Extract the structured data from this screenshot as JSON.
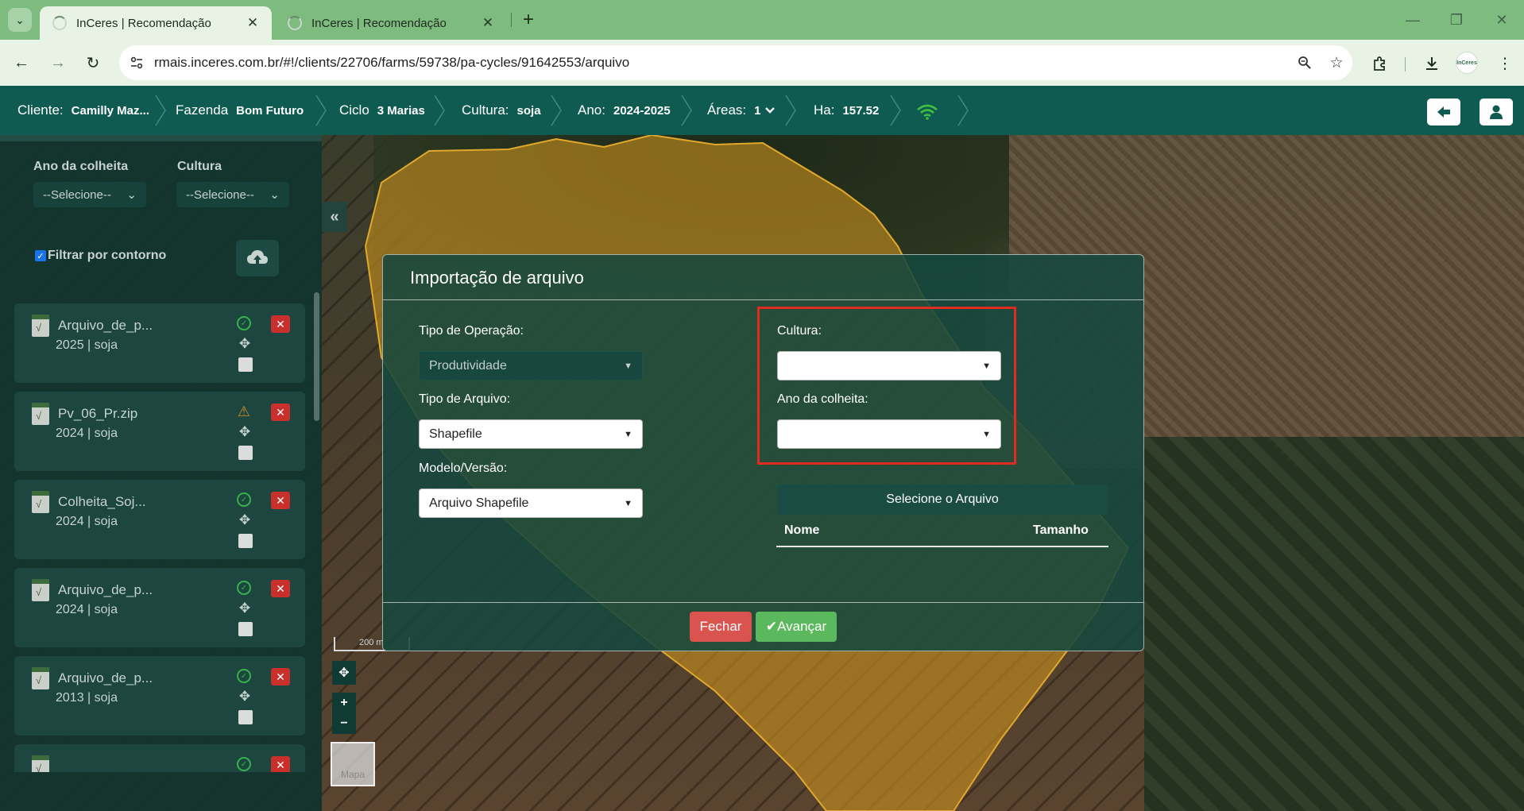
{
  "browser": {
    "tabs": [
      {
        "title": "InCeres | Recomendação",
        "active": true
      },
      {
        "title": "InCeres | Recomendação",
        "active": false
      }
    ],
    "url": "rmais.inceres.com.br/#!/clients/22706/farms/59738/pa-cycles/91642553/arquivo",
    "profile_text": "InCeres"
  },
  "header": {
    "crumbs": [
      {
        "label": "Cliente:",
        "value": "Camilly Maz..."
      },
      {
        "label": "Fazenda",
        "value": "Bom Futuro"
      },
      {
        "label": "Ciclo",
        "value": "3 Marias"
      },
      {
        "label": "Cultura:",
        "value": "soja"
      },
      {
        "label": "Ano:",
        "value": "2024-2025"
      },
      {
        "label": "Áreas:",
        "value": "1"
      },
      {
        "label": "Ha:",
        "value": "157.52"
      }
    ],
    "wifi_color": "#3fbf3f",
    "bar_color": "#0f5b51"
  },
  "sidebar": {
    "filter_year_label": "Ano da colheita",
    "filter_crop_label": "Cultura",
    "filter_year_value": "--Selecione--",
    "filter_crop_value": "--Selecione--",
    "contour_filter_label": "Filtrar por contorno",
    "contour_filter_checked": true,
    "files": [
      {
        "name": "Arquivo_de_p...",
        "sub": "2025 | soja",
        "status": "ok"
      },
      {
        "name": "Pv_06_Pr.zip",
        "sub": "2024 | soja",
        "status": "warning"
      },
      {
        "name": "Colheita_Soj...",
        "sub": "2024 | soja",
        "status": "ok"
      },
      {
        "name": "Arquivo_de_p...",
        "sub": "2024 | soja",
        "status": "ok"
      },
      {
        "name": "Arquivo_de_p...",
        "sub": "2013 | soja",
        "status": "ok"
      }
    ]
  },
  "map": {
    "scale_label": "200 m",
    "map_type_label": "Mapa",
    "zoom_in": "+",
    "zoom_out": "−"
  },
  "modal": {
    "title": "Importação de arquivo",
    "operation_type_label": "Tipo de Operação:",
    "operation_type_value": "Produtividade",
    "file_type_label": "Tipo de Arquivo:",
    "file_type_value": "Shapefile",
    "model_label": "Modelo/Versão:",
    "model_value": "Arquivo Shapefile",
    "crop_label": "Cultura:",
    "crop_value": "",
    "harvest_year_label": "Ano da colheita:",
    "harvest_year_value": "",
    "select_file_label": "Selecione o Arquivo",
    "table_headers": {
      "name": "Nome",
      "size": "Tamanho"
    },
    "close_label": "Fechar",
    "next_label": "✔Avançar",
    "highlight_color": "#e02b20"
  }
}
